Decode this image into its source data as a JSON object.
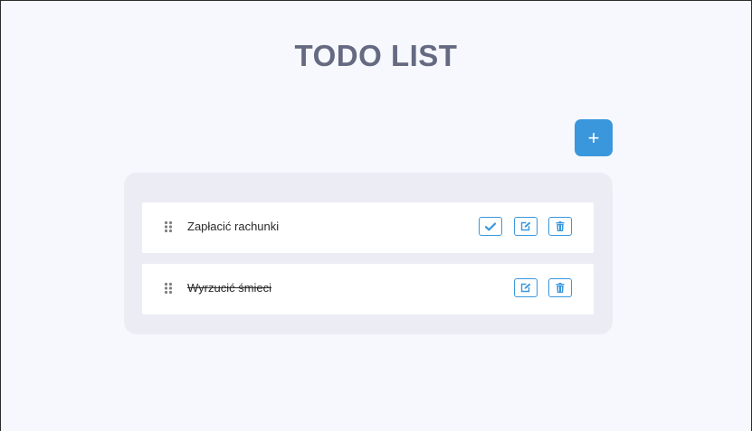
{
  "header": {
    "title": "TODO LIST"
  },
  "add_button": {
    "label": "+"
  },
  "todos": [
    {
      "text": "Zapłacić rachunki",
      "completed": false
    },
    {
      "text": "Wyrzucić śmieci",
      "completed": true
    }
  ],
  "colors": {
    "accent": "#3a97dc",
    "title": "#656a82",
    "panel_bg": "#ececf5",
    "page_bg": "#f7f8fd"
  }
}
